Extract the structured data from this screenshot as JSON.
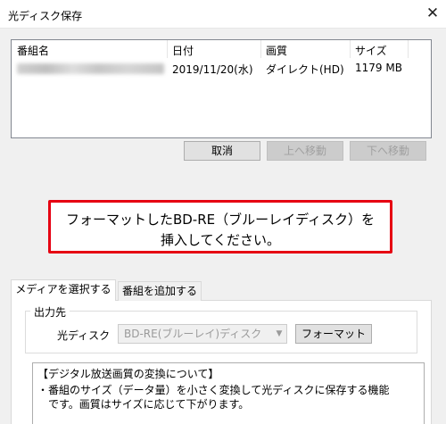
{
  "window": {
    "title": "光ディスク保存",
    "close_glyph": "✕"
  },
  "listview": {
    "columns": [
      "番組名",
      "日付",
      "画質",
      "サイズ"
    ],
    "rows": [
      {
        "date": "2019/11/20(水)",
        "quality": "ダイレクト(HD)",
        "size": "1179 MB"
      }
    ]
  },
  "buttons": {
    "cancel": "取消",
    "move_up": "上へ移動",
    "move_down": "下へ移動"
  },
  "message": {
    "line1": "フォーマットしたBD-RE（ブルーレイディスク）を",
    "line2": "挿入してください。",
    "highlight_color": "#e60012"
  },
  "tabs": [
    {
      "label": "メディアを選択する",
      "active": true
    },
    {
      "label": "番組を追加する",
      "active": false
    }
  ],
  "output": {
    "group_label": "出力先",
    "field_label": "光ディスク",
    "selected_media": "BD-RE(ブルーレイ)ディスク",
    "format_button": "フォーマット"
  },
  "info": {
    "lines": [
      "【デジタル放送画質の変換について】",
      "・番組のサイズ（データ量）を小さく変換して光ディスクに保存する機能",
      "　です。画質はサイズに応じて下がります。"
    ]
  }
}
